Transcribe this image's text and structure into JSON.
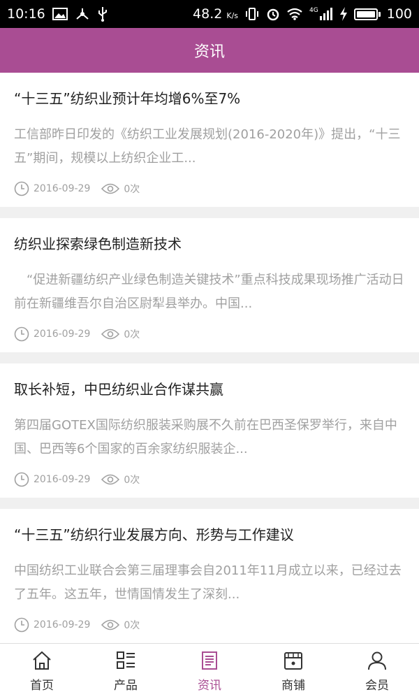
{
  "status_bar": {
    "time": "10:16",
    "speed": "48.2",
    "speed_unit": "K/s",
    "network": "4G",
    "battery": "100"
  },
  "header": {
    "title": "资讯"
  },
  "news": [
    {
      "title": "“十三五”纺织业预计年均增6%至7%",
      "summary": "工信部昨日印发的《纺织工业发展规划(2016-2020年)》提出，“十三五”期间，规模以上纺织企业工...",
      "date": "2016-09-29",
      "views": "0次"
    },
    {
      "title": "纺织业探索绿色制造新技术",
      "summary": "　“促进新疆纺织产业绿色制造关键技术”重点科技成果现场推广活动日前在新疆维吾尔自治区尉犁县举办。中国...",
      "date": "2016-09-29",
      "views": "0次"
    },
    {
      "title": "取长补短，中巴纺织业合作谋共赢",
      "summary": "第四届GOTEX国际纺织服装采购展不久前在巴西圣保罗举行，来自中国、巴西等6个国家的百余家纺织服装企...",
      "date": "2016-09-29",
      "views": "0次"
    },
    {
      "title": "“十三五”纺织行业发展方向、形势与工作建议",
      "summary": "中国纺织工业联合会第三届理事会自2011年11月成立以来，已经过去了五年。这五年，世情国情发生了深刻...",
      "date": "2016-09-29",
      "views": "0次"
    }
  ],
  "tabs": [
    {
      "label": "首页",
      "icon": "home-icon"
    },
    {
      "label": "产品",
      "icon": "list-icon"
    },
    {
      "label": "资讯",
      "icon": "news-icon",
      "active": true
    },
    {
      "label": "商铺",
      "icon": "store-icon"
    },
    {
      "label": "会员",
      "icon": "user-icon"
    }
  ],
  "colors": {
    "accent": "#a94d93",
    "muted_text": "#a0a0a0"
  }
}
